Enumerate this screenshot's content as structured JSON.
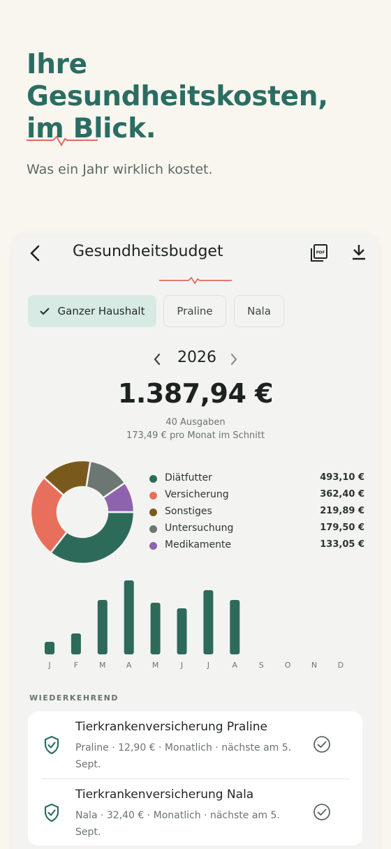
{
  "hero": {
    "title": "Ihre Gesundheitskosten,\nim Blick.",
    "subtitle": "Was ein Jahr wirklich kostet."
  },
  "nav": {
    "title": "Gesundheitsbudget",
    "back_icon": "chevron-left-icon",
    "pdf_icon": "pdf-icon",
    "download_icon": "download-icon"
  },
  "filters": [
    {
      "label": "Ganzer Haushalt",
      "active": true
    },
    {
      "label": "Praline",
      "active": false
    },
    {
      "label": "Nala",
      "active": false
    }
  ],
  "year": "2026",
  "summary": {
    "total": "1.387,94 €",
    "count": "40 Ausgaben",
    "average": "173,49 € pro Monat im Schnitt"
  },
  "colors": {
    "accent": "#2b6d63",
    "pulse": "#e06a5c",
    "bar": "#2e6a5a"
  },
  "chart_data": [
    {
      "type": "pie",
      "categories": [
        "Diätfutter",
        "Versicherung",
        "Sonstiges",
        "Untersuchung",
        "Medikamente"
      ],
      "values": [
        493.1,
        362.4,
        219.89,
        179.5,
        133.05
      ],
      "value_labels": [
        "493,10 €",
        "362,40 €",
        "219,89 €",
        "179,50 €",
        "133,05 €"
      ],
      "colors": [
        "#2e6a5a",
        "#e76f5b",
        "#7a5a1c",
        "#6c7773",
        "#8e63ad"
      ],
      "donut": true,
      "legend": "right"
    },
    {
      "type": "bar",
      "categories": [
        "J",
        "F",
        "M",
        "A",
        "M",
        "J",
        "J",
        "A",
        "S",
        "O",
        "N",
        "D"
      ],
      "values": [
        18,
        30,
        78,
        106,
        74,
        66,
        92,
        78,
        0,
        0,
        0,
        0
      ],
      "grid": false,
      "color": "#2e6a5a"
    }
  ],
  "recurring": {
    "section_label": "WIEDERKEHREND",
    "items": [
      {
        "title": "Tierkrankenversicherung Praline",
        "subtitle": "Praline · 12,90 € · Monatlich · nächste am 5. Sept.",
        "icon": "shield-icon",
        "status_icon": "check-circle-icon"
      },
      {
        "title": "Tierkrankenversicherung Nala",
        "subtitle": "Nala · 32,40 € · Monatlich · nächste am 5. Sept.",
        "icon": "shield-icon",
        "status_icon": "check-circle-icon"
      }
    ]
  }
}
